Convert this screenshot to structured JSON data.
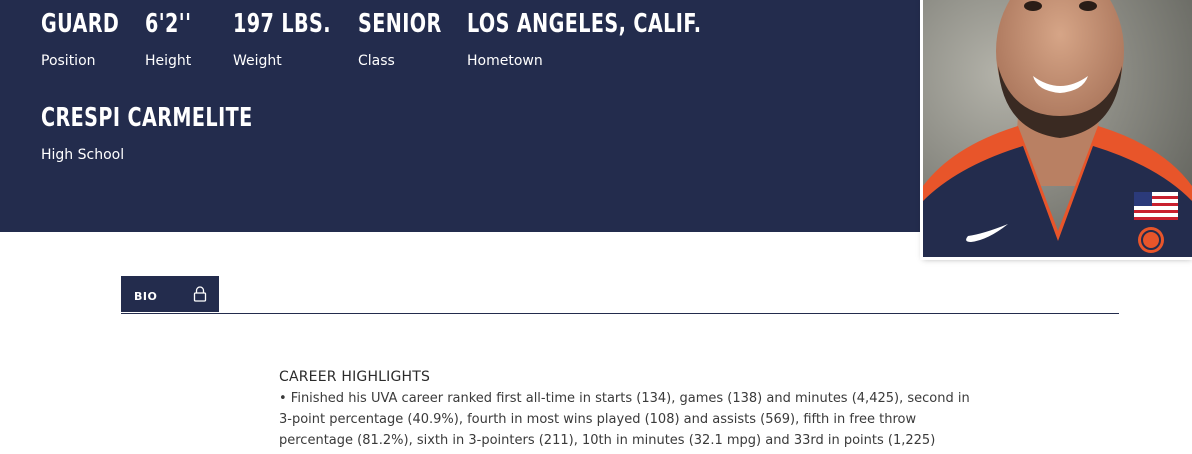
{
  "player": {
    "position": {
      "value": "GUARD",
      "label": "Position"
    },
    "height": {
      "value": "6'2''",
      "label": "Height"
    },
    "weight": {
      "value": "197 LBS.",
      "label": "Weight"
    },
    "class": {
      "value": "SENIOR",
      "label": "Class"
    },
    "hometown": {
      "value": "LOS ANGELES, CALIF.",
      "label": "Hometown"
    },
    "high_school": {
      "value": "CRESPI CARMELITE",
      "label": "High School"
    }
  },
  "tabs": [
    {
      "label": "BIO",
      "icon": "lock-icon",
      "active": true
    }
  ],
  "bio": {
    "heading": "CAREER HIGHLIGHTS",
    "text": "• Finished his UVA career ranked first all-time in starts (134), games (138) and minutes (4,425), second in 3-point percentage (40.9%), fourth in most wins played (108) and assists (569), fifth in free throw percentage (81.2%), sixth in 3-pointers (211), 10th in minutes (32.1 mpg) and 33rd in points (1,225)"
  },
  "colors": {
    "navy": "#232c4d",
    "orange": "#e8552a",
    "white": "#ffffff"
  }
}
